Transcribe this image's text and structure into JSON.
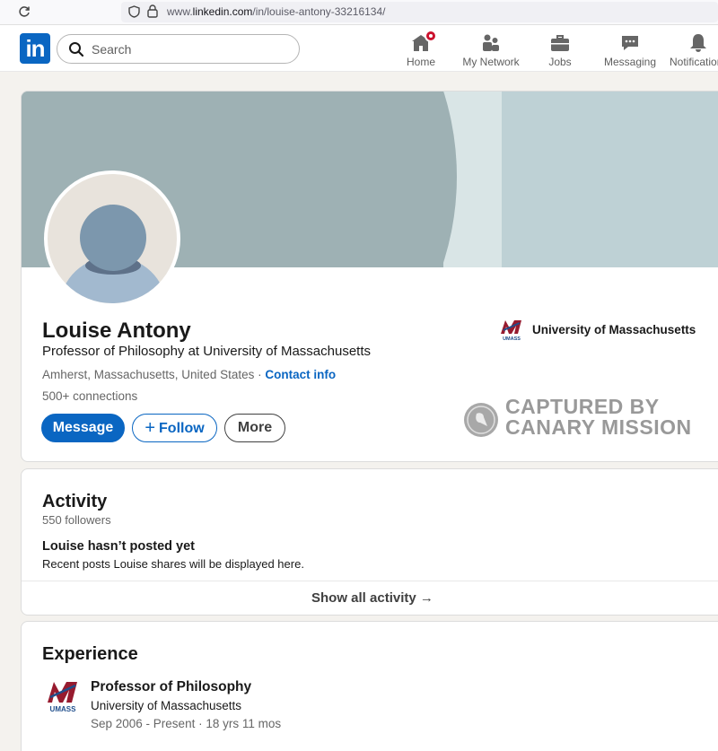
{
  "browser": {
    "url_prefix": "www.",
    "url_domain": "linkedin.com",
    "url_path": "/in/louise-antony-33216134/"
  },
  "nav": {
    "logo": "in",
    "search_placeholder": "Search",
    "items": [
      {
        "label": "Home",
        "icon": "home-icon"
      },
      {
        "label": "My Network",
        "icon": "network-icon"
      },
      {
        "label": "Jobs",
        "icon": "briefcase-icon"
      },
      {
        "label": "Messaging",
        "icon": "message-icon"
      },
      {
        "label": "Notifications",
        "icon": "bell-icon"
      }
    ]
  },
  "profile": {
    "name": "Louise Antony",
    "headline": "Professor of Philosophy at University of Massachusetts",
    "location": "Amherst, Massachusetts, United States",
    "separator": " · ",
    "contact_info": "Contact info",
    "connections_count": "500+",
    "connections_label": " connections",
    "current_company": "University of Massachusetts",
    "buttons": {
      "message": "Message",
      "follow": "Follow",
      "more": "More"
    }
  },
  "watermark": {
    "line1": "CAPTURED BY",
    "line2": "CANARY MISSION"
  },
  "activity": {
    "title": "Activity",
    "followers": "550 followers",
    "empty_title": "Louise hasn’t posted yet",
    "empty_sub": "Recent posts Louise shares will be displayed here.",
    "show_all": "Show all activity →"
  },
  "experience": {
    "title": "Experience",
    "items": [
      {
        "title": "Professor of Philosophy",
        "company": "University of Massachusetts",
        "dates": "Sep 2006 - Present · 18 yrs 11 mos"
      }
    ]
  },
  "logo_text": "UMASS",
  "colors": {
    "linkedin_blue": "#0a66c2",
    "umass_maroon": "#971b2f",
    "notification_red": "#cb112d"
  }
}
